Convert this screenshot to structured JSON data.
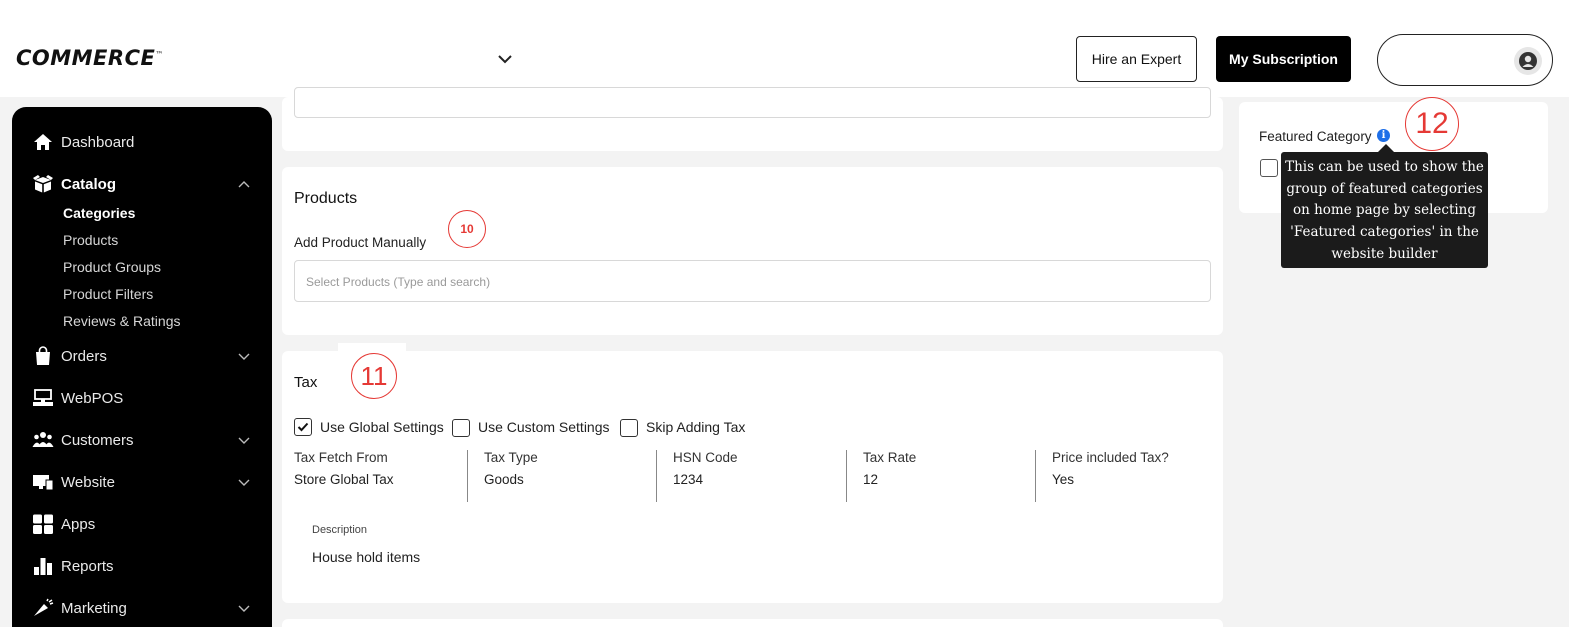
{
  "header": {
    "logo": "COMMERCE",
    "logo_tm": "™",
    "hire_expert": "Hire an Expert",
    "my_subscription": "My Subscription"
  },
  "sidebar": {
    "items": [
      {
        "label": "Dashboard",
        "icon": "home-icon"
      },
      {
        "label": "Catalog",
        "icon": "box-icon"
      },
      {
        "label": "Orders",
        "icon": "shopping-bag-icon"
      },
      {
        "label": "WebPOS",
        "icon": "pos-icon"
      },
      {
        "label": "Customers",
        "icon": "users-icon"
      },
      {
        "label": "Website",
        "icon": "monitor-icon"
      },
      {
        "label": "Apps",
        "icon": "apps-grid-icon"
      },
      {
        "label": "Reports",
        "icon": "bar-chart-icon"
      },
      {
        "label": "Marketing",
        "icon": "megaphone-icon"
      }
    ],
    "catalog_sub": [
      "Categories",
      "Products",
      "Product Groups",
      "Product Filters",
      "Reviews & Ratings"
    ]
  },
  "products": {
    "title": "Products",
    "add_manually": "Add Product Manually",
    "placeholder": "Select Products (Type and search)"
  },
  "tax": {
    "title": "Tax",
    "options": [
      "Use Global Settings",
      "Use Custom Settings",
      "Skip Adding Tax"
    ],
    "checked": [
      true,
      false,
      false
    ],
    "columns": [
      {
        "key": "Tax Fetch From",
        "value": "Store Global Tax"
      },
      {
        "key": "Tax Type",
        "value": "Goods"
      },
      {
        "key": "HSN Code",
        "value": "1234"
      },
      {
        "key": "Tax Rate",
        "value": "12"
      },
      {
        "key": "Price included Tax?",
        "value": "Yes"
      }
    ],
    "description_label": "Description",
    "description_value": "House hold items"
  },
  "featured": {
    "label": "Featured Category",
    "tooltip": [
      "This can be used to show the",
      "group of featured categories",
      "on home page by selecting",
      "'Featured categories' in the",
      "website builder"
    ]
  },
  "annotations": [
    "10",
    "11",
    "12"
  ],
  "colors": {
    "accent": "#000000",
    "annotation": "#e53935",
    "info": "#1e6fe8"
  }
}
